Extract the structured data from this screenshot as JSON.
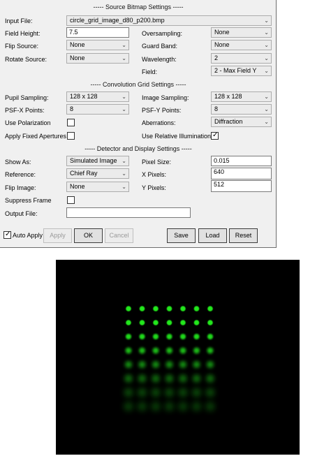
{
  "sections": {
    "source": "----- Source Bitmap Settings -----",
    "convolution": "----- Convolution Grid Settings -----",
    "detector": "----- Detector and Display Settings -----"
  },
  "source": {
    "input_file_label": "Input File:",
    "input_file_value": "circle_grid_image_d80_p200.bmp",
    "field_height_label": "Field Height:",
    "field_height_value": "7.5",
    "oversampling_label": "Oversampling:",
    "oversampling_value": "None",
    "flip_source_label": "Flip Source:",
    "flip_source_value": "None",
    "guard_band_label": "Guard Band:",
    "guard_band_value": "None",
    "rotate_source_label": "Rotate Source:",
    "rotate_source_value": "None",
    "wavelength_label": "Wavelength:",
    "wavelength_value": "2",
    "field_label": "Field:",
    "field_value": "2 - Max Field Y"
  },
  "convolution": {
    "pupil_sampling_label": "Pupil Sampling:",
    "pupil_sampling_value": "128 x 128",
    "image_sampling_label": "Image Sampling:",
    "image_sampling_value": "128 x 128",
    "psfx_label": "PSF-X Points:",
    "psfx_value": "8",
    "psfy_label": "PSF-Y Points:",
    "psfy_value": "8",
    "use_polarization_label": "Use Polarization",
    "use_polarization_checked": false,
    "aberrations_label": "Aberrations:",
    "aberrations_value": "Diffraction",
    "apply_fixed_apertures_label": "Apply Fixed Apertures",
    "apply_fixed_apertures_checked": false,
    "use_relative_illumination_label": "Use Relative Illumination",
    "use_relative_illumination_checked": true
  },
  "detector": {
    "show_as_label": "Show As:",
    "show_as_value": "Simulated Image",
    "pixel_size_label": "Pixel Size:",
    "pixel_size_value": "0.015",
    "reference_label": "Reference:",
    "reference_value": "Chief Ray",
    "x_pixels_label": "X Pixels:",
    "x_pixels_value": "640",
    "flip_image_label": "Flip Image:",
    "flip_image_value": "None",
    "y_pixels_label": "Y Pixels:",
    "y_pixels_value": "512",
    "suppress_frame_label": "Suppress Frame",
    "suppress_frame_checked": false,
    "output_file_label": "Output File:",
    "output_file_value": ""
  },
  "buttons": {
    "auto_apply_label": "Auto Apply",
    "auto_apply_checked": true,
    "apply": "Apply",
    "ok": "OK",
    "cancel": "Cancel",
    "save": "Save",
    "load": "Load",
    "reset": "Reset"
  },
  "image": {
    "background_color": "#000000",
    "spot_color": "#21e81d",
    "grid_columns": 7,
    "grid_rows": 8,
    "row_sharpness": [
      1.0,
      1.0,
      0.9,
      0.75,
      0.55,
      0.35,
      0.2,
      0.1
    ]
  },
  "icons": {
    "dropdown": "chevron-down-icon",
    "checkmark": "checkmark-icon"
  }
}
